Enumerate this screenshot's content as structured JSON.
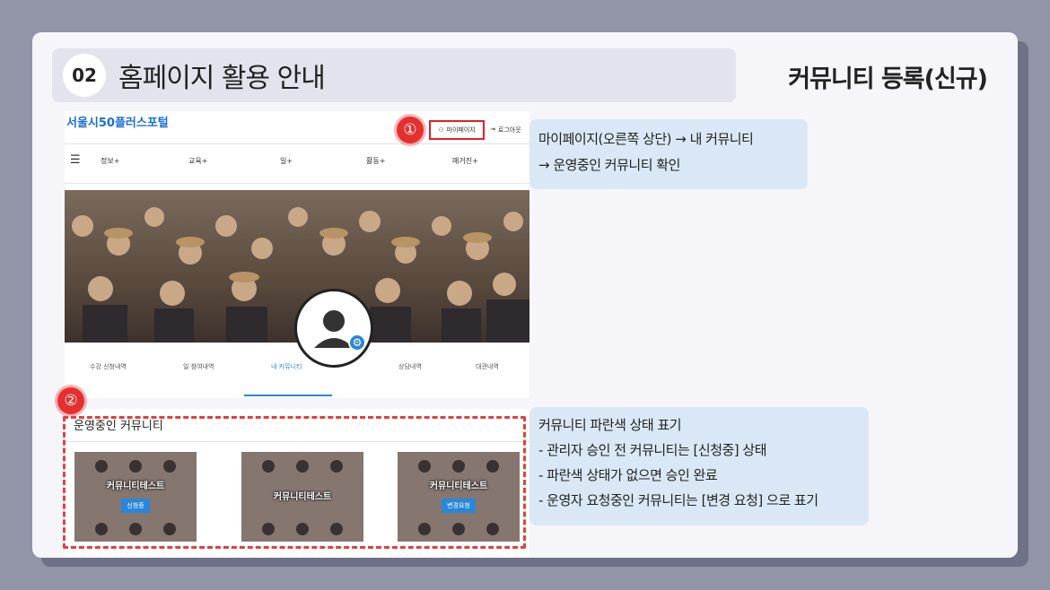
{
  "header": {
    "section_number": "02",
    "title": "홈페이지 활용 안내",
    "section_title": "커뮤니티 등록(신규)"
  },
  "site": {
    "logo": "서울시50플러스포털",
    "mypage_label": "마이페이지",
    "logout_label": "로그아웃",
    "nav_items": [
      "정보+",
      "교육+",
      "일+",
      "활동+",
      "매거진+"
    ],
    "tabs": [
      "수강 신청내역",
      "일 참여내역",
      "내 커뮤니티",
      "상담내역",
      "대관내역"
    ]
  },
  "markers": {
    "first": "①",
    "second": "②"
  },
  "callout_top": {
    "line1": "마이페이지(오른쪽 상단) → 내 커뮤니티",
    "line2": "→ 운영중인 커뮤니티 확인"
  },
  "community": {
    "heading": "운영중인 커뮤니티",
    "cards": [
      {
        "title": "커뮤니티테스트",
        "badge": "신청중"
      },
      {
        "title": "커뮤니티테스트",
        "badge": ""
      },
      {
        "title": "커뮤니티테스트",
        "badge": "변경요청"
      }
    ]
  },
  "callout_bottom": {
    "line1": "커뮤니티  파란색 상태 표기",
    "line2": "- 관리자 승인 전 커뮤니티는 [신청중] 상태",
    "line3": "- 파란색 상태가 없으면 승인 완료",
    "line4": "- 운영자 요청중인 커뮤니티는 [변경 요청] 으로 표기"
  },
  "colors": {
    "accent_blue": "#2a87d8",
    "highlight_red": "#e0202a",
    "callout_bg": "#d9e8f4"
  },
  "icons": {
    "menu": "hamburger-icon",
    "user": "person-icon",
    "logout": "logout-icon",
    "settings": "gear-icon"
  }
}
